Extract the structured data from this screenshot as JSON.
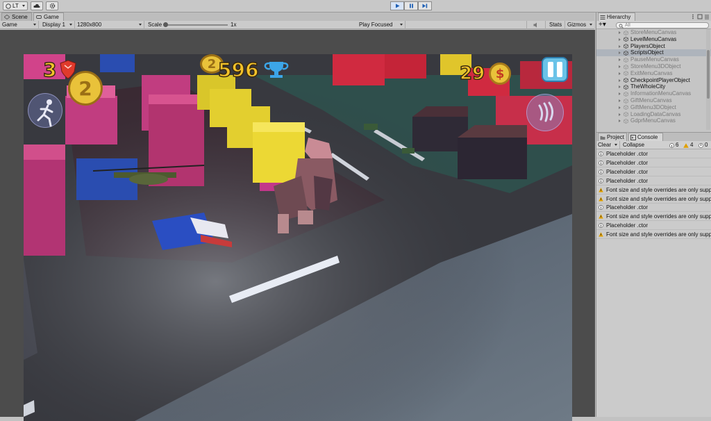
{
  "toolbar": {
    "account_label": "LT",
    "cloud_icon": "cloud-icon",
    "gear_icon": "gear-icon",
    "play_icon": "play-icon",
    "pause_icon": "pause-icon",
    "step_icon": "step-icon"
  },
  "scene_tabs": {
    "scene": "Scene",
    "game": "Game"
  },
  "game_bar": {
    "view": "Game",
    "display": "Display 1",
    "resolution": "1280x800",
    "scale_label": "Scale",
    "scale_value": "1x",
    "scale_fraction": 0.0,
    "play_mode": "Play Focused",
    "stats": "Stats",
    "gizmos": "Gizmos"
  },
  "hud": {
    "lives": "3",
    "score": "596",
    "coins": "29",
    "coin_symbol": "$",
    "level_symbol": "2"
  },
  "hierarchy": {
    "title": "Hierarchy",
    "search_placeholder": "All",
    "items": [
      {
        "label": "StoreMenuCanvas",
        "active": false
      },
      {
        "label": "LevelMenuCanvas",
        "active": true
      },
      {
        "label": "PlayersObject",
        "active": true
      },
      {
        "label": "ScriptsObject",
        "active": true,
        "selected": true
      },
      {
        "label": "PauseMenuCanvas",
        "active": false
      },
      {
        "label": "StoreMenu3DObject",
        "active": false
      },
      {
        "label": "ExitMenuCanvas",
        "active": false
      },
      {
        "label": "CheckpointPlayerObject",
        "active": true
      },
      {
        "label": "TheWholeCity",
        "active": true
      },
      {
        "label": "InformationMenuCanvas",
        "active": false
      },
      {
        "label": "GiftMenuCanvas",
        "active": false
      },
      {
        "label": "GiftMenu3DObject",
        "active": false
      },
      {
        "label": "LoadingDataCanvas",
        "active": false
      },
      {
        "label": "GdprMenuCanvas",
        "active": false
      }
    ]
  },
  "console": {
    "project_tab": "Project",
    "console_tab": "Console",
    "clear": "Clear",
    "collapse": "Collapse",
    "info_count": "6",
    "warn_count": "4",
    "error_count": "0",
    "entries": [
      {
        "type": "info",
        "text": "Placeholder .ctor"
      },
      {
        "type": "info",
        "text": "Placeholder .ctor"
      },
      {
        "type": "info",
        "text": "Placeholder .ctor"
      },
      {
        "type": "info",
        "text": "Placeholder .ctor"
      },
      {
        "type": "warn",
        "text": "Font size and style overrides are only supported"
      },
      {
        "type": "warn",
        "text": "Font size and style overrides are only supported"
      },
      {
        "type": "info",
        "text": "Placeholder .ctor"
      },
      {
        "type": "warn",
        "text": "Font size and style overrides are only supported"
      },
      {
        "type": "info",
        "text": "Placeholder .ctor"
      },
      {
        "type": "warn",
        "text": "Font size and style overrides are only supported"
      }
    ]
  },
  "colors": {
    "play_accent": "#1e5fb5",
    "hud_text": "#f3c22a",
    "warning": "#e0a000",
    "selection": "#aeb4bc"
  }
}
